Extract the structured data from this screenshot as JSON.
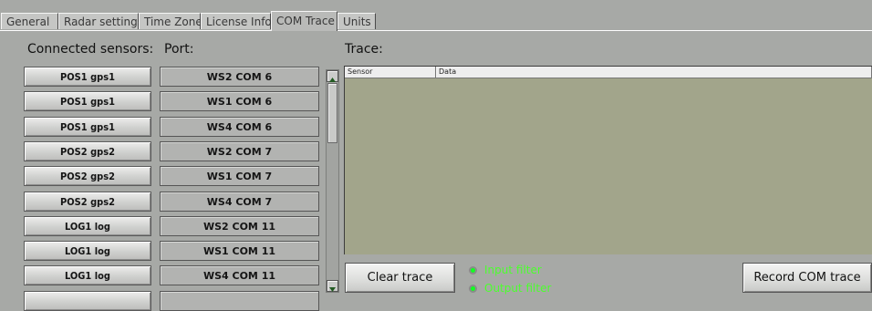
{
  "tabs": [
    "General",
    "Radar settings",
    "Time Zone",
    "License Info",
    "COM Trace",
    "Units"
  ],
  "active_tab": "COM Trace",
  "headers": {
    "sensors": "Connected sensors:",
    "port": "Port:",
    "trace": "Trace:"
  },
  "sensors": [
    {
      "sensor": "POS1 gps1",
      "port": "WS2 COM 6"
    },
    {
      "sensor": "POS1 gps1",
      "port": "WS1 COM 6"
    },
    {
      "sensor": "POS1 gps1",
      "port": "WS4 COM 6"
    },
    {
      "sensor": "POS2 gps2",
      "port": "WS2 COM 7"
    },
    {
      "sensor": "POS2 gps2",
      "port": "WS1 COM 7"
    },
    {
      "sensor": "POS2 gps2",
      "port": "WS4 COM 7"
    },
    {
      "sensor": "LOG1 log",
      "port": "WS2 COM 11"
    },
    {
      "sensor": "LOG1 log",
      "port": "WS1 COM 11"
    },
    {
      "sensor": "LOG1 log",
      "port": "WS4 COM 11"
    }
  ],
  "trace_columns": [
    "Sensor",
    "Data"
  ],
  "buttons": {
    "clear": "Clear trace",
    "record": "Record COM trace"
  },
  "filters": {
    "input": "Input filter",
    "output": "Output filter"
  },
  "colors": {
    "background": "#a7a9a6",
    "trace_area": "#a2a58b",
    "filter_text": "#4cff2e"
  }
}
